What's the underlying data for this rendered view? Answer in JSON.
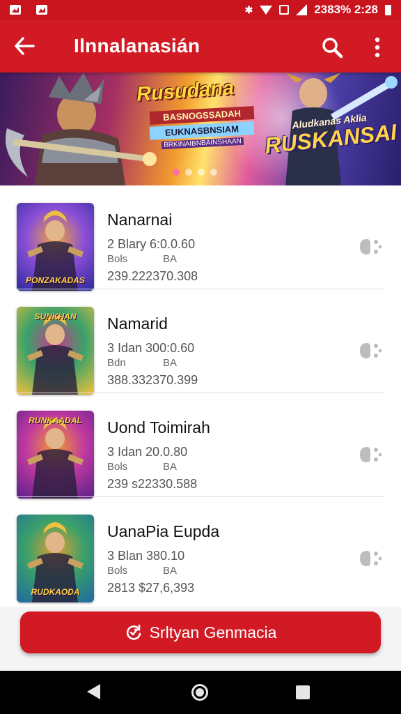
{
  "status_bar": {
    "text": "2383% 2:28"
  },
  "app_bar": {
    "title": "Ilnnalanasián",
    "back_icon": "arrow-left-icon",
    "search_icon": "search-icon",
    "more_icon": "more-vertical-icon"
  },
  "banner": {
    "title": "Rusudana",
    "sub1": "BASNOGSSADAH",
    "sub2": "EUKNASBNSIAM",
    "sub3": "BRKINAIBNBAINSHAAN",
    "tag_small": "Aludkanas Aklia",
    "tag_big": "RUSKANSAI",
    "page_count": 4,
    "active_page": 0
  },
  "games": [
    {
      "name": "Nanarnai",
      "meta1": "2 Blary 6:0.0.60",
      "meta2a": "Bols",
      "meta2b": "BA",
      "meta3": "239.222370.308",
      "thumb_label": "PONZAKADAS",
      "thumb_colors": [
        "#2b2a9a",
        "#8a4fd6",
        "#f0a53a"
      ]
    },
    {
      "name": "Namarid",
      "meta1": "3 Idan 300:0.60",
      "meta2a": "Bdn",
      "meta2b": "BA",
      "meta3": "388.332370.399",
      "thumb_label": "SUNKHAN",
      "thumb_colors": [
        "#f2c23a",
        "#3aa16a",
        "#c83a8a"
      ]
    },
    {
      "name": "Uond Toimirah",
      "meta1": "3 Idan 20.0.80",
      "meta2a": "Bols",
      "meta2b": "BA",
      "meta3": "239 s22330.588",
      "thumb_label": "RUNKAADAL",
      "thumb_colors": [
        "#5a1f8a",
        "#c03aa0",
        "#f29a2e"
      ]
    },
    {
      "name": "UanaPia Eupda",
      "meta1": "3 Blan 380.10",
      "meta2a": "Bols",
      "meta2b": "BA",
      "meta3": "2813 $27,6,393",
      "thumb_label": "RUDKAODA",
      "thumb_colors": [
        "#1f6aa0",
        "#3aa06a",
        "#e0a030"
      ]
    }
  ],
  "row_action_icon": "game-controller-icon",
  "cta": {
    "label": "Srltyan Genmacia",
    "icon": "refresh-icon"
  },
  "nav": {
    "back_icon": "nav-back-icon",
    "home_icon": "nav-home-icon",
    "recent_icon": "nav-recent-icon"
  }
}
